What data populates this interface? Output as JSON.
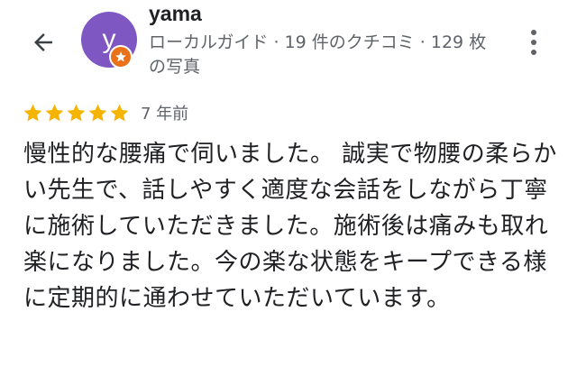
{
  "header": {
    "back_icon": "arrow-back-icon",
    "more_icon": "more-vert-icon"
  },
  "reviewer": {
    "avatar_letter": "y",
    "avatar_color": "#7e57c2",
    "badge_color": "#e8711a",
    "badge_icon": "local-guide-star-icon",
    "name": "yama",
    "meta": "ローカルガイド · 19 件のクチコミ · 129 枚の写真"
  },
  "review": {
    "rating": 5,
    "rating_max": 5,
    "star_color": "#f4b400",
    "date": "7 年前",
    "text": "慢性的な腰痛で伺いました。 誠実で物腰の柔らかい先生で、話しやすく適度な会話をしながら丁寧に施術していただきました。施術後は痛みも取れ楽になりました。今の楽な状態をキープできる様に定期的に通わせていただいています。"
  }
}
